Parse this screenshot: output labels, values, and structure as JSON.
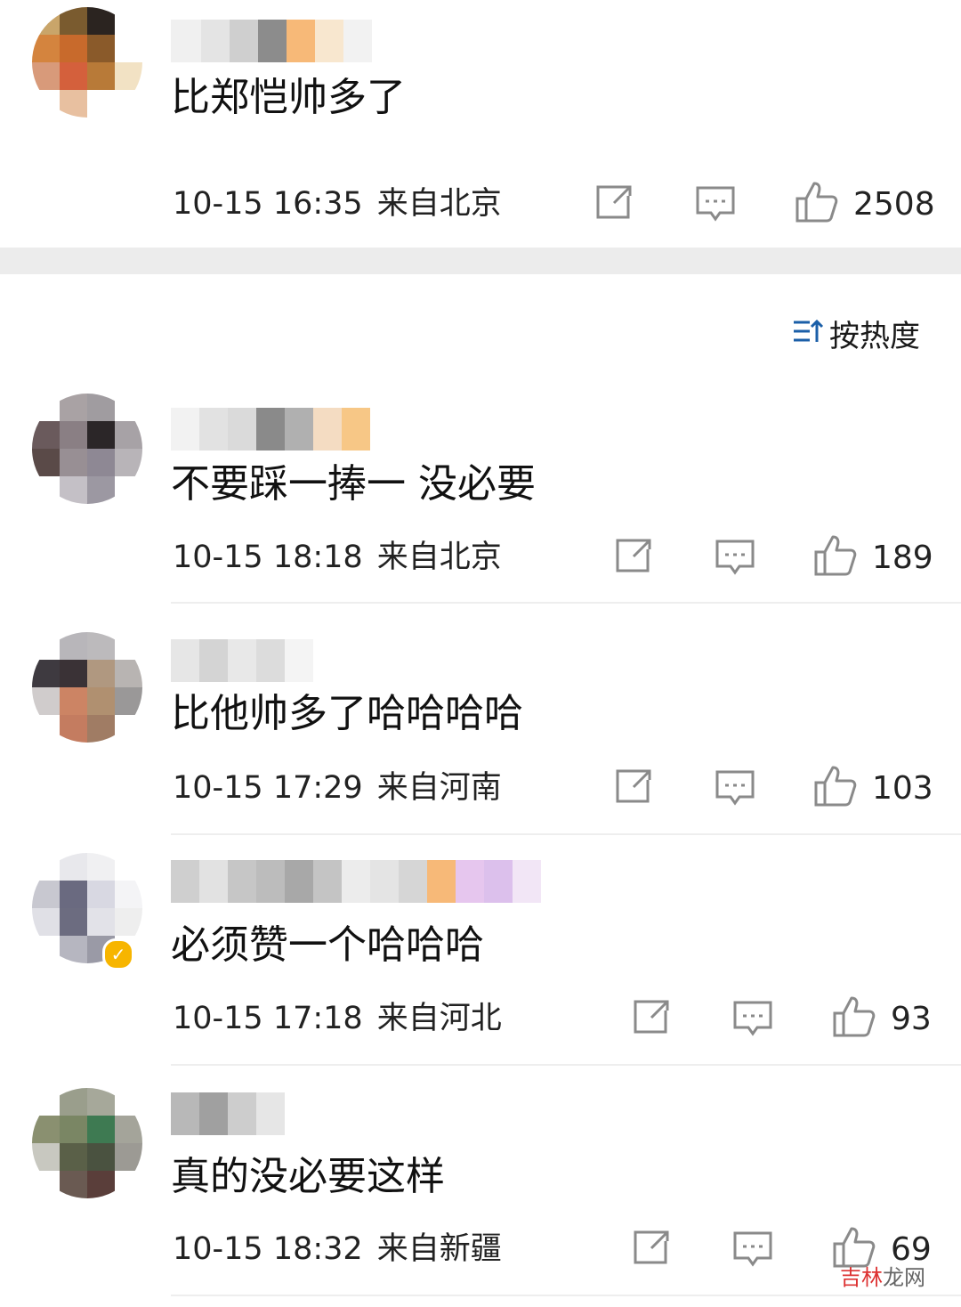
{
  "comments": [
    {
      "text": "比郑恺帅多了",
      "date": "10-15 16:35",
      "location": "来自北京",
      "likes": "2508",
      "icons": {
        "forward": "forward-icon",
        "reply": "comment-icon",
        "like": "thumbs-up-icon"
      }
    },
    {
      "text": "不要踩一捧一 没必要",
      "date": "10-15 18:18",
      "location": "来自北京",
      "likes": "189"
    },
    {
      "text": "比他帅多了哈哈哈哈",
      "date": "10-15 17:29",
      "location": "来自河南",
      "likes": "103"
    },
    {
      "text": "必须赞一个哈哈哈",
      "date": "10-15 17:18",
      "location": "来自河北",
      "likes": "93",
      "verified": true
    },
    {
      "text": "真的没必要这样",
      "date": "10-15 18:32",
      "location": "来自新疆",
      "likes": "69"
    }
  ],
  "sort": {
    "label": "按热度",
    "icon": "sort-icon"
  },
  "watermark": {
    "part1": "吉林",
    "part2": "龙网"
  },
  "colors": {
    "divider": "#eeeeee",
    "section_gap": "#ececec",
    "icon": "#8a8a8a",
    "badge": "#f7b500"
  }
}
